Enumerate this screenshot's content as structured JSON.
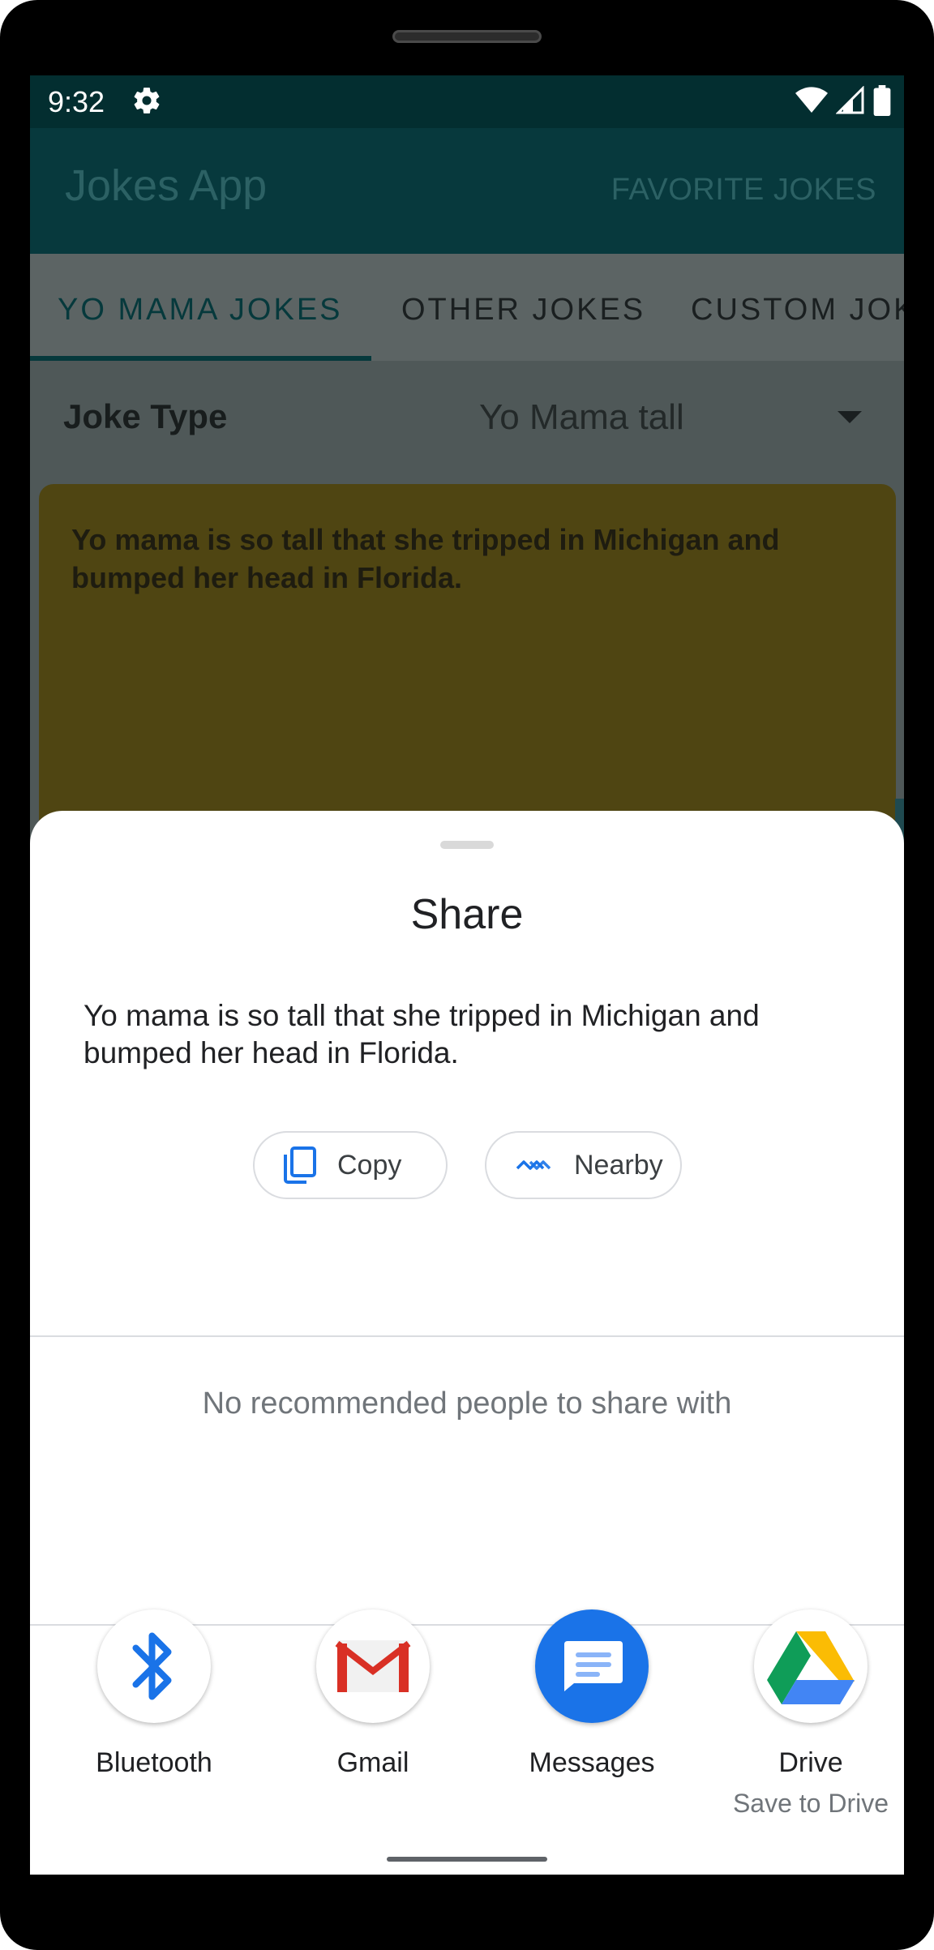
{
  "status_bar": {
    "time": "9:32",
    "icons": [
      "settings-gear-icon",
      "wifi-icon",
      "signal-icon",
      "battery-icon"
    ]
  },
  "app_bar": {
    "title": "Jokes App",
    "action_label": "FAVORITE JOKES"
  },
  "tabs": [
    {
      "label": "YO MAMA JOKES",
      "selected": true
    },
    {
      "label": "OTHER JOKES",
      "selected": false
    },
    {
      "label": "CUSTOM JOKES",
      "selected": false
    }
  ],
  "joke_type": {
    "label": "Joke Type",
    "selected_value": "Yo Mama tall"
  },
  "joke_card": {
    "text": "Yo mama is so tall that she tripped in Michigan and bumped her head in Florida."
  },
  "share_sheet": {
    "title": "Share",
    "shared_text": "Yo mama is so tall that she tripped in Michigan and bumped her head in Florida.",
    "chips": [
      {
        "label": "Copy",
        "icon": "copy-icon"
      },
      {
        "label": "Nearby",
        "icon": "nearby-share-icon"
      }
    ],
    "no_people_text": "No recommended people to share with",
    "apps": [
      {
        "label": "Bluetooth",
        "sublabel": "",
        "icon": "bluetooth-icon"
      },
      {
        "label": "Gmail",
        "sublabel": "",
        "icon": "gmail-icon"
      },
      {
        "label": "Messages",
        "sublabel": "",
        "icon": "messages-icon"
      },
      {
        "label": "Drive",
        "sublabel": "Save to Drive",
        "icon": "drive-icon"
      }
    ]
  },
  "colors": {
    "status_bar": "#032e30",
    "app_bar": "#07393d",
    "scrim_content": "#4f5858",
    "joke_card": "#4f4512",
    "accent_blue": "#1a73e8",
    "sheet_background": "#ffffff"
  }
}
